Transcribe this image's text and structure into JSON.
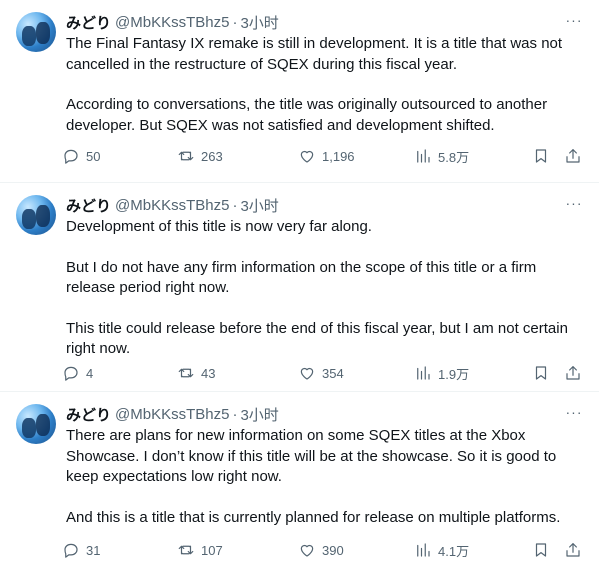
{
  "tweets": [
    {
      "display_name": "みどり",
      "handle": "@MbKKssTBhz5",
      "separator": "·",
      "time": "3小时",
      "more": "···",
      "paragraphs": [
        "The Final Fantasy IX remake is still in development. It is a title that was not cancelled in the restructure of SQEX during this fiscal year.",
        "According to conversations, the title was originally outsourced to another developer. But SQEX was not satisfied and development shifted."
      ],
      "stats": {
        "replies": "50",
        "retweets": "263",
        "likes": "1,196",
        "views": "5.8万"
      }
    },
    {
      "display_name": "みどり",
      "handle": "@MbKKssTBhz5",
      "separator": "·",
      "time": "3小时",
      "more": "···",
      "paragraphs": [
        "Development of this title is now very far along.",
        "But I do not have any firm information on the scope of this title or a firm release period right now.",
        "This title could release before the end of this fiscal year, but I am not certain right now."
      ],
      "stats": {
        "replies": "4",
        "retweets": "43",
        "likes": "354",
        "views": "1.9万"
      }
    },
    {
      "display_name": "みどり",
      "handle": "@MbKKssTBhz5",
      "separator": "·",
      "time": "3小时",
      "more": "···",
      "paragraphs": [
        "There are plans for new information on some SQEX titles at the Xbox Showcase. I don’t know if this title will be at the showcase. So it is good to keep expectations low right now.",
        "And this is a title that is currently planned for release on multiple platforms."
      ],
      "stats": {
        "replies": "31",
        "retweets": "107",
        "likes": "390",
        "views": "4.1万"
      }
    }
  ],
  "icons": [
    "reply-icon",
    "retweet-icon",
    "like-icon",
    "views-icon",
    "bookmark-icon",
    "share-icon",
    "more-icon"
  ],
  "colors": {
    "text": "#0f1419",
    "muted": "#536471",
    "divider": "#eff3f4"
  }
}
